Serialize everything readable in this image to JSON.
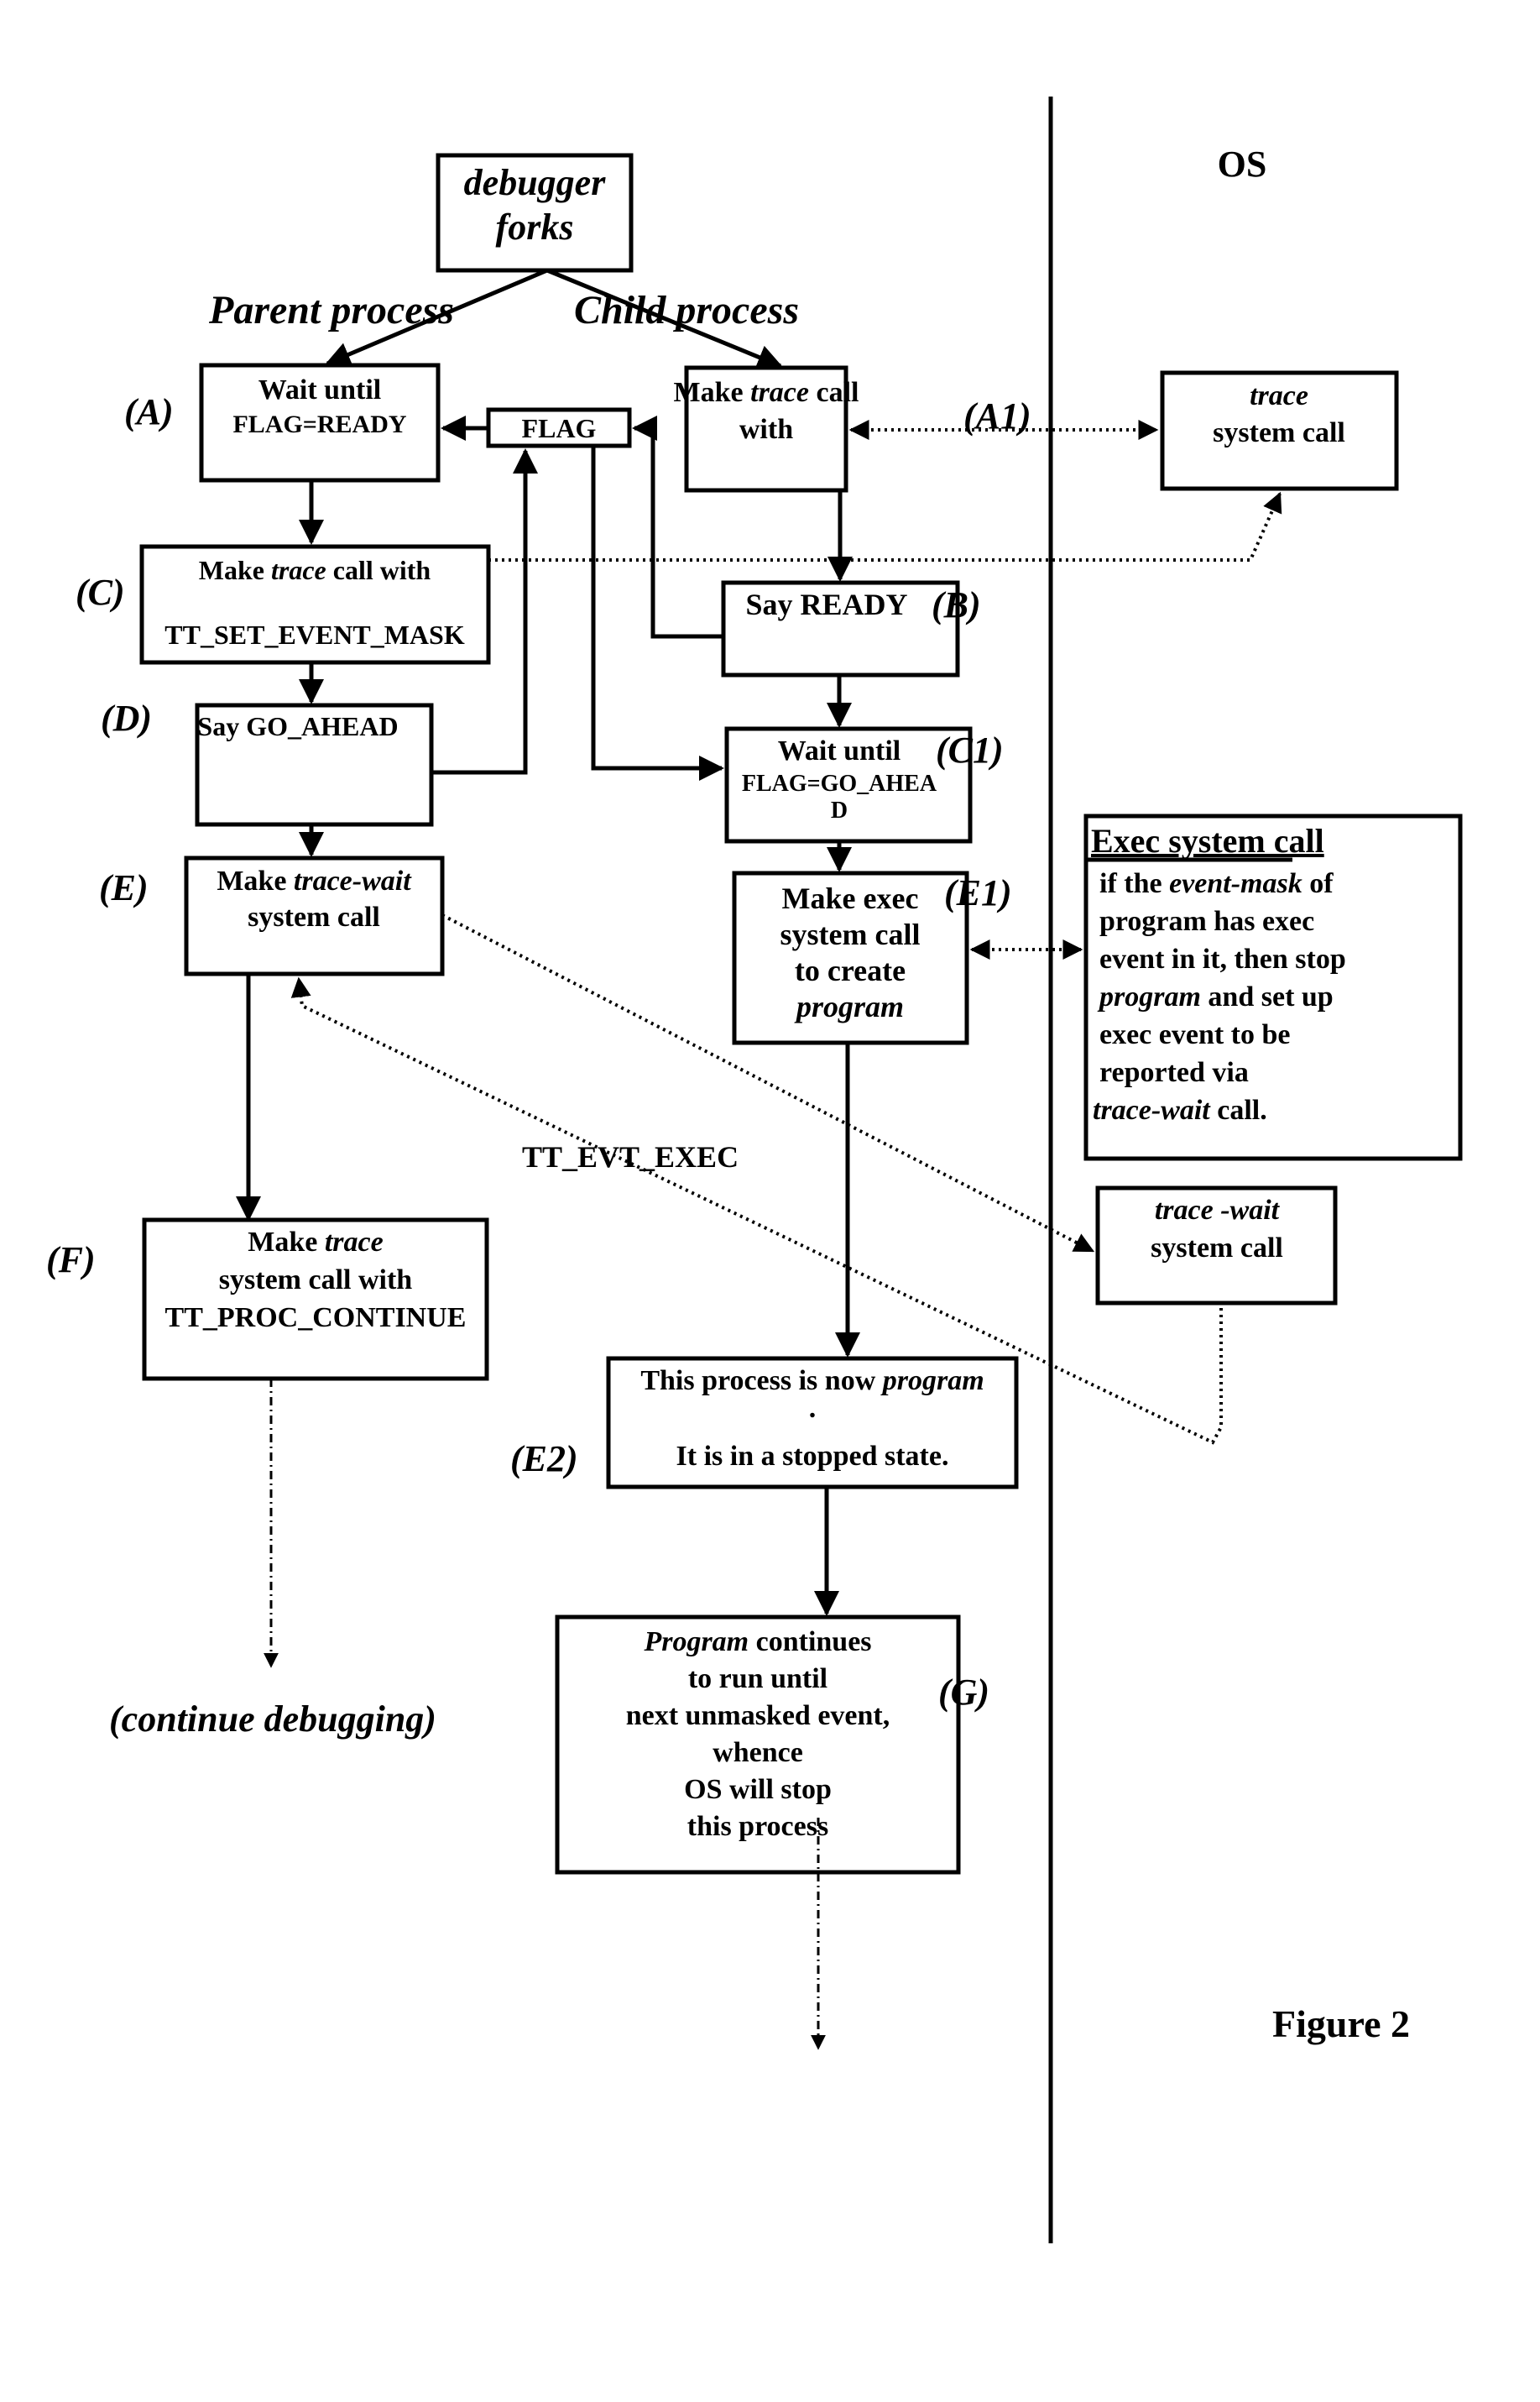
{
  "figure": {
    "label": "Figure 2",
    "os_column_label": "OS",
    "colors": {
      "ink": "#000000",
      "background": "#ffffff"
    }
  },
  "nodes": {
    "fork": {
      "lines": [
        "debugger",
        "forks"
      ]
    },
    "branch_parent": "Parent process",
    "branch_child": "Child process",
    "A": {
      "tag": "(A)",
      "lines": [
        "Wait until",
        "FLAG=READY"
      ]
    },
    "flag": {
      "text": "FLAG"
    },
    "A1": {
      "tag": "(A1)",
      "line1_pre": "Make ",
      "line1_em": "trace",
      "line1_post": " call",
      "line2": "with"
    },
    "os_trace": {
      "line1_em": "trace",
      "line2": "system call"
    },
    "C": {
      "tag": "(C)",
      "line1_pre": "Make ",
      "line1_em": "trace",
      "line1_post": " call with",
      "line2": "TT_SET_EVENT_MASK"
    },
    "B": {
      "tag": "(B)",
      "text": "Say READY"
    },
    "D": {
      "tag": "(D)",
      "text": "Say GO_AHEAD"
    },
    "C1": {
      "tag": "(C1)",
      "lines": [
        "Wait until",
        "FLAG=GO_AHEA",
        "D"
      ]
    },
    "E": {
      "tag": "(E)",
      "line1_pre": "Make ",
      "line1_em": "trace-wait",
      "line2": "system  call"
    },
    "E1": {
      "tag": "(E1)",
      "lines": [
        "Make exec",
        "system call",
        "to create"
      ],
      "line4_em": "program"
    },
    "os_exec": {
      "title": "Exec system call",
      "l1_pre": "if the ",
      "l1_em": "event-mask",
      "l1_post": " of",
      "l2": "program has exec",
      "l3": "event in it, then stop",
      "l4_em": "program",
      "l4_post": " and set up",
      "l5": "exec event to be",
      "l6": "reported via",
      "l7_em": "trace-wait",
      "l7_post": " call."
    },
    "event_label": "TT_EVT_EXEC",
    "os_tracewait": {
      "line1_em": "trace -wait",
      "line2": "system call"
    },
    "F": {
      "tag": "(F)",
      "line1_pre": "Make ",
      "line1_em": "trace",
      "line2": "system  call with",
      "line3": "TT_PROC_CONTINUE"
    },
    "E2": {
      "tag": "(E2)",
      "line1_pre": "This process is now ",
      "line1_em": "program",
      "dot": ".",
      "line2": "It is in a stopped state."
    },
    "G": {
      "tag": "(G)",
      "line1_em": "Program",
      "line1_post": " continues",
      "lines": [
        "to run until",
        "next unmasked event,",
        "whence",
        "OS will stop",
        "this process"
      ]
    },
    "continue": "(continue debugging)"
  }
}
